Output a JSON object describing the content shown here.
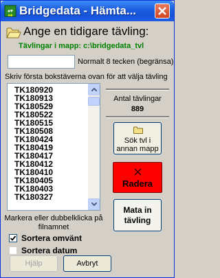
{
  "window": {
    "title": "Bridgedata - Hämta..."
  },
  "header": {
    "heading": "Ange en tidigare tävling:",
    "folder_info": "Tävlingar i mapp: c:\\bridgedata_tvl"
  },
  "filter": {
    "value": "",
    "hint": "Normalt 8 tecken (begränsa)"
  },
  "instruction": "Skriv första bokstäverna ovan för att välja tävling",
  "competitions": [
    "TK180920",
    "TK180913",
    "TK180529",
    "TK180522",
    "TK180515",
    "TK180508",
    "TK180424",
    "TK180419",
    "TK180417",
    "TK180412",
    "TK180410",
    "TK180405",
    "TK180403",
    "TK180327"
  ],
  "count": {
    "label": "Antal tävlingar",
    "value": "889"
  },
  "buttons": {
    "search_folder": "Sök tvl i annan mapp",
    "delete": "Radera",
    "enter": "Mata in tävling",
    "help": "Hjälp",
    "cancel": "Avbryt"
  },
  "selection_hint": "Markera eller dubbelklicka på filnamnet",
  "options": {
    "sort_reverse": {
      "label": "Sortera omvänt",
      "checked": true
    },
    "sort_date": {
      "label": "Sortera datum",
      "checked": false
    }
  },
  "colors": {
    "folder_text": "#008000",
    "delete_button": "#ff0000",
    "titlebar": "#1f62e0"
  }
}
